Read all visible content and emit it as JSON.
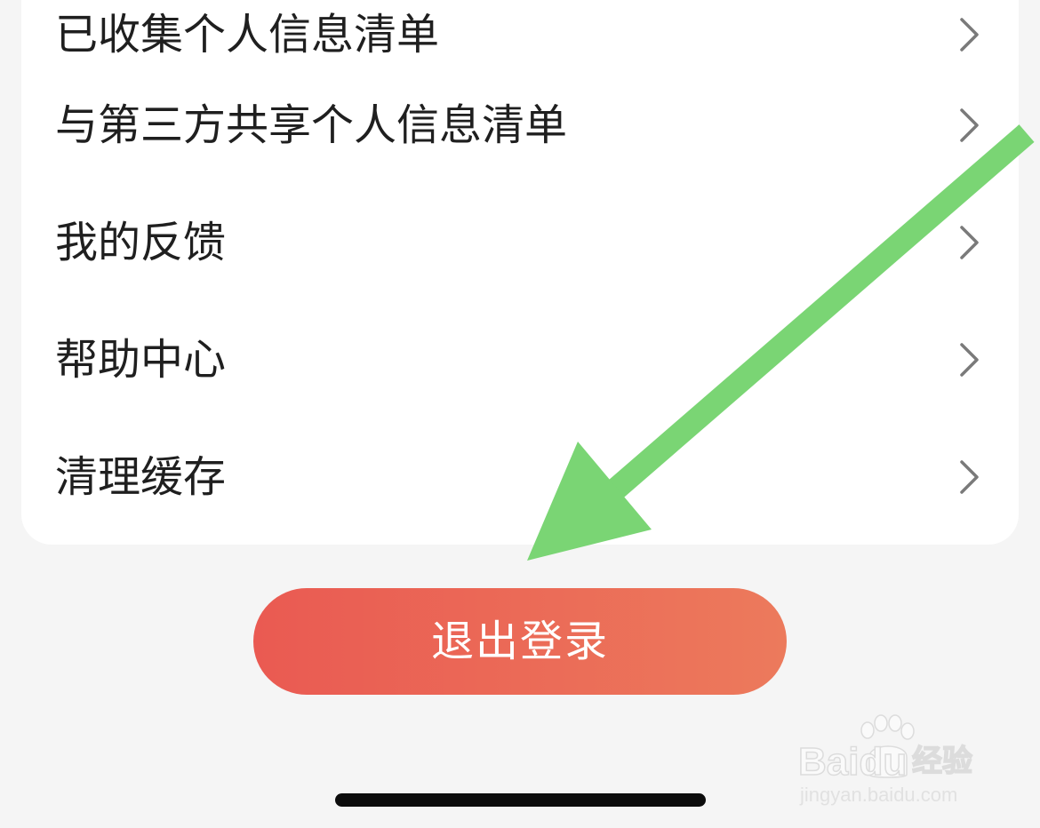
{
  "menu": {
    "items": [
      {
        "label": "已收集个人信息清单"
      },
      {
        "label": "与第三方共享个人信息清单"
      },
      {
        "label": "我的反馈"
      },
      {
        "label": "帮助中心"
      },
      {
        "label": "清理缓存"
      }
    ]
  },
  "logout": {
    "label": "退出登录"
  },
  "watermark": {
    "brand": "Baidu",
    "product": "经验",
    "url": "jingyan.baidu.com"
  },
  "colors": {
    "background": "#f5f5f5",
    "card": "#ffffff",
    "text": "#1f1f1f",
    "chevron": "#7a7a7a",
    "button_start": "#ea5a52",
    "button_end": "#ec7a5c",
    "arrow": "#7ad574"
  },
  "icons": {
    "chevron": "chevron-right-icon",
    "arrow": "annotation-arrow",
    "watermark_logo": "baidu-paw-icon"
  }
}
